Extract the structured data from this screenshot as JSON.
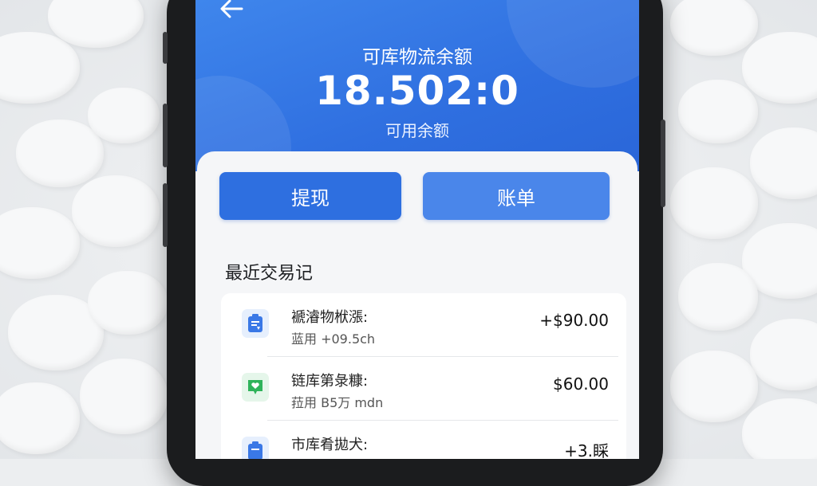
{
  "header": {
    "back_icon": "back-arrow-icon",
    "title": "可库物流余额",
    "balance": "18.502:0",
    "balance_label": "可用余额"
  },
  "actions": {
    "withdraw_label": "提现",
    "bill_label": "账单"
  },
  "transactions_section": {
    "title": "最近交易记",
    "items": [
      {
        "name": "褫濬物栿漲:",
        "meta": "蓝用 +09.5ch",
        "amount": "+$90.00",
        "icon": "clipboard-icon",
        "icon_color": "#3a78e6"
      },
      {
        "name": "链库第彔糠:",
        "meta": "菈用 B5万 mdn",
        "amount": "$60.00",
        "icon": "heart-chat-icon",
        "icon_color": "#2fb35a"
      },
      {
        "name": "市库肴拋犬:",
        "meta": "",
        "amount": "+3.睬",
        "icon": "clipboard-icon",
        "icon_color": "#3a78e6"
      }
    ]
  },
  "colors": {
    "header_blue": "#2f6fe0",
    "button_blue": "#2e6fe0",
    "button_blue_light": "#4a86ea"
  }
}
